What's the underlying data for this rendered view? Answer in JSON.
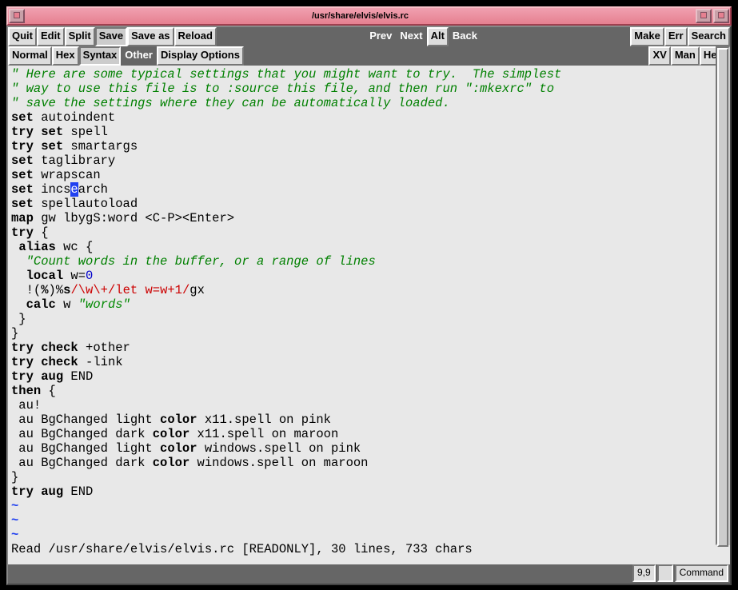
{
  "title": "/usr/share/elvis/elvis.rc",
  "toolbar1": {
    "quit": "Quit",
    "edit": "Edit",
    "split": "Split",
    "save": "Save",
    "saveas": "Save as",
    "reload": "Reload",
    "prev": "Prev",
    "next": "Next",
    "alt": "Alt",
    "back": "Back",
    "make": "Make",
    "err": "Err",
    "search": "Search"
  },
  "toolbar2": {
    "normal": "Normal",
    "hex": "Hex",
    "syntax": "Syntax",
    "other": "Other",
    "display": "Display Options",
    "xv": "XV",
    "man": "Man",
    "help": "Help"
  },
  "lines": {
    "c1": "\" Here are some typical settings that you might want to try.  The simplest",
    "c2": "\" way to use this file is to :source this file, and then run \":mkexrc\" to",
    "c3": "\" save the settings where they can be automatically loaded."
  },
  "status_msg": "Read /usr/share/elvis/elvis.rc [READONLY], 30 lines, 733 chars",
  "pos": "9,9",
  "mode": "Command",
  "txt": {
    "set": "set",
    "try": "try",
    "map": "map",
    "alias": "alias",
    "local": "local",
    "calc": "calc",
    "check": "check",
    "aug": "aug",
    "then": "then",
    "color": "color",
    "autoindent": " autoindent",
    "spell": " spell",
    "smartargs": " smartargs",
    "taglibrary": " taglibrary",
    "wrapscan": " wrapscan",
    "incs_pre": " incs",
    "incs_cur": "e",
    "incs_post": "arch",
    "spellautoload": " spellautoload",
    "map_rest": " gw lbygS:word <C-P><Enter>",
    "try_open": " {",
    "wc_open": " wc {",
    "wc_comment": "  \"Count words in the buffer, or a range of lines",
    "local_w": " w=",
    "zero": "0",
    "bang": "  !(",
    "pct": "%",
    "close_s": ")%",
    "s_key": "s",
    "regex": "/\\w\\+/let w=w+1/",
    "gx": "gx",
    "calc_w": " w ",
    "words_str": "\"words\"",
    "cb": " }",
    "cb0": "}",
    "other": " +other",
    "link": " -link",
    "end": " END",
    "then_open": " {",
    "au_bang": " au!",
    "au1a": " au BgChanged light ",
    "au1b": " x11.spell on pink",
    "au2a": " au BgChanged dark ",
    "au2b": " x11.spell on maroon",
    "au3a": " au BgChanged light ",
    "au3b": " windows.spell on pink",
    "au4a": " au BgChanged dark ",
    "au4b": " windows.spell on maroon",
    "tilde": "~"
  }
}
